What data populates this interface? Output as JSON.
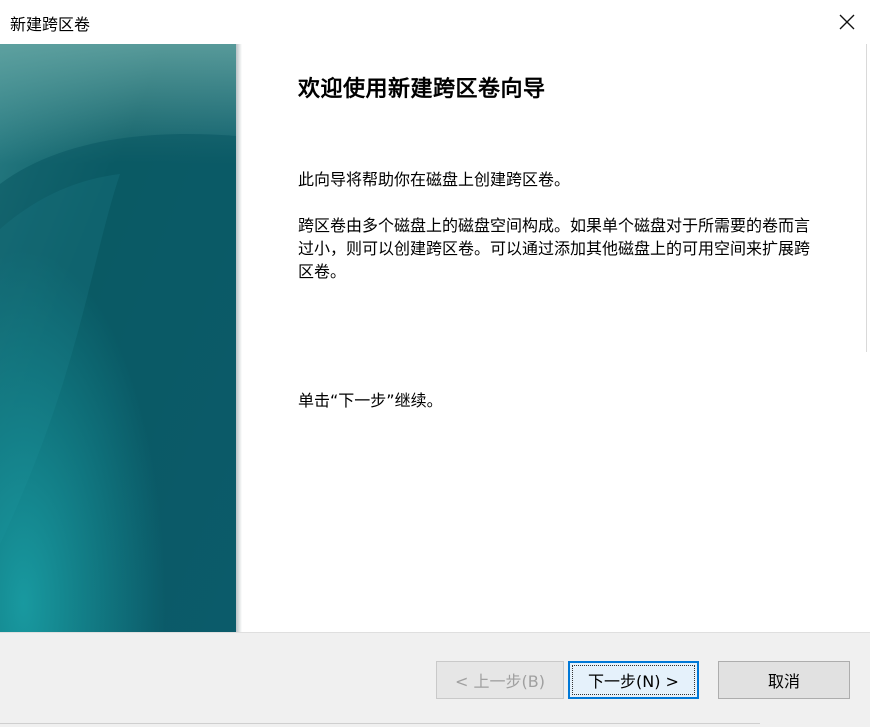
{
  "window": {
    "title": "新建跨区卷"
  },
  "icons": {
    "close": "close-icon"
  },
  "main": {
    "heading": "欢迎使用新建跨区卷向导",
    "intro": "此向导将帮助你在磁盘上创建跨区卷。",
    "description": "跨区卷由多个磁盘上的磁盘空间构成。如果单个磁盘对于所需要的卷而言过小，则可以创建跨区卷。可以通过添加其他磁盘上的可用空间来扩展跨区卷。",
    "instruction": "单击“下一步”继续。"
  },
  "footer": {
    "back_label": "< 上一步(B)",
    "next_label": "下一步(N) >",
    "cancel_label": "取消"
  },
  "colors": {
    "art_dark": "#0b5a68",
    "art_light": "#1e7f8c",
    "focus": "#0078d7"
  }
}
